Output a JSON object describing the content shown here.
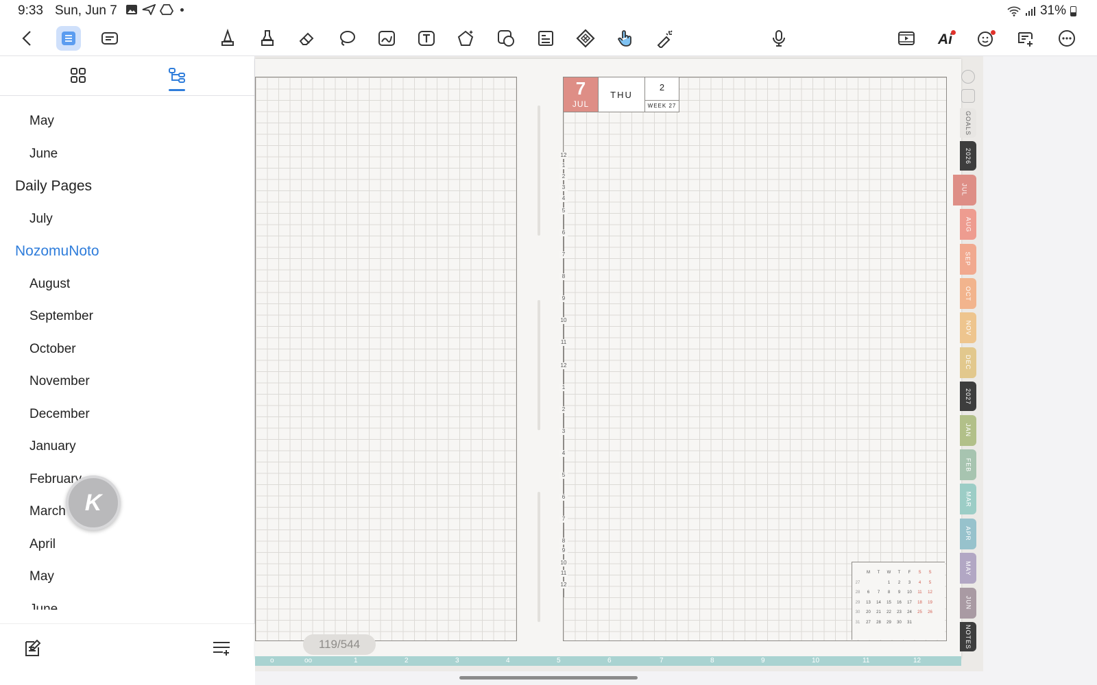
{
  "status": {
    "time": "9:33",
    "date": "Sun, Jun 7",
    "battery": "31%"
  },
  "sidebar": {
    "outline": [
      {
        "label": "May",
        "level": 2
      },
      {
        "label": "June",
        "level": 2
      },
      {
        "label": "Daily Pages",
        "level": 1
      },
      {
        "label": "July",
        "level": 2
      },
      {
        "label": "NozomuNoto",
        "level": 1,
        "highlight": true
      },
      {
        "label": "August",
        "level": 2
      },
      {
        "label": "September",
        "level": 2
      },
      {
        "label": "October",
        "level": 2
      },
      {
        "label": "November",
        "level": 2
      },
      {
        "label": "December",
        "level": 2
      },
      {
        "label": "January",
        "level": 2
      },
      {
        "label": "February",
        "level": 2
      },
      {
        "label": "March",
        "level": 2
      },
      {
        "label": "April",
        "level": 2
      },
      {
        "label": "May",
        "level": 2
      },
      {
        "label": "June",
        "level": 2
      }
    ],
    "fab_letter": "K"
  },
  "page": {
    "indicator": "119/544",
    "date_box": {
      "day": "7",
      "month": "JUL",
      "weekday": "THU",
      "week_num": "2",
      "week_label": "WEEK 27"
    },
    "hours": [
      "12",
      "1",
      "2",
      "3",
      "4",
      "5",
      "6",
      "7",
      "8",
      "9",
      "10",
      "11",
      "12",
      "1",
      "2",
      "3",
      "4",
      "5",
      "6",
      "7",
      "8",
      "9",
      "10",
      "11",
      "12"
    ],
    "mini_calendar": {
      "header": [
        "M",
        "T",
        "W",
        "T",
        "F",
        "S",
        "S"
      ],
      "weeks": [
        "27",
        "28",
        "29",
        "30",
        "31"
      ],
      "rows": [
        [
          "",
          "",
          "1",
          "2",
          "3",
          "4",
          "5"
        ],
        [
          "6",
          "7",
          "8",
          "9",
          "10",
          "11",
          "12"
        ],
        [
          "13",
          "14",
          "15",
          "16",
          "17",
          "18",
          "19"
        ],
        [
          "20",
          "21",
          "22",
          "23",
          "24",
          "25",
          "26"
        ],
        [
          "27",
          "28",
          "29",
          "30",
          "31",
          "",
          ""
        ]
      ]
    },
    "ruler": [
      "o",
      "oo",
      "1",
      "2",
      "3",
      "4",
      "5",
      "6",
      "7",
      "8",
      "9",
      "10",
      "11",
      "12"
    ]
  },
  "month_tabs": [
    {
      "label": "GOALS",
      "color": "#e8e6e3",
      "text": "#666"
    },
    {
      "label": "2026",
      "color": "#3d3d3d",
      "text": "#fff"
    },
    {
      "label": "JUL",
      "color": "#de8e86",
      "text": "#fff",
      "active": true
    },
    {
      "label": "AUG",
      "color": "#ee9c90",
      "text": "#fff"
    },
    {
      "label": "SEP",
      "color": "#f1a98f",
      "text": "#fff"
    },
    {
      "label": "OCT",
      "color": "#f2b48d",
      "text": "#fff"
    },
    {
      "label": "NOV",
      "color": "#eec58e",
      "text": "#fff"
    },
    {
      "label": "DEC",
      "color": "#e2c88d",
      "text": "#fff"
    },
    {
      "label": "2027",
      "color": "#3d3d3d",
      "text": "#fff"
    },
    {
      "label": "JAN",
      "color": "#b2c089",
      "text": "#fff"
    },
    {
      "label": "FEB",
      "color": "#a7c4b0",
      "text": "#fff"
    },
    {
      "label": "MAR",
      "color": "#9ccdc6",
      "text": "#fff"
    },
    {
      "label": "APR",
      "color": "#97c2cc",
      "text": "#fff"
    },
    {
      "label": "MAY",
      "color": "#b2a7c4",
      "text": "#fff"
    },
    {
      "label": "JUN",
      "color": "#a99aa3",
      "text": "#fff"
    },
    {
      "label": "NOTES",
      "color": "#3d3d3d",
      "text": "#fff"
    }
  ],
  "toolbar_icons": [
    "back-icon",
    "outline-icon",
    "page-text-icon",
    "pen-icon",
    "highlighter-icon",
    "eraser-icon",
    "lasso-icon",
    "image-icon",
    "text-box-icon",
    "shapes-icon",
    "sticker-icon",
    "table-icon",
    "ruler-icon",
    "hand-icon",
    "laser-pointer-icon",
    "microphone-icon",
    "slideshow-icon",
    "ai-icon",
    "emoji-icon",
    "comment-icon",
    "more-icon"
  ]
}
